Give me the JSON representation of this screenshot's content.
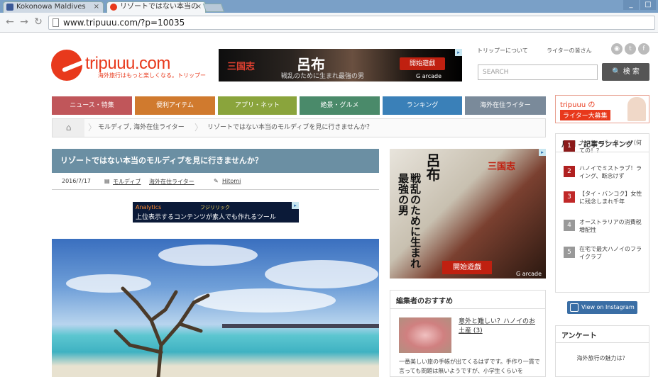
{
  "browser": {
    "tabs": [
      {
        "title": "Kokonowa Maldives",
        "active": false
      },
      {
        "title": "リゾートではない本当の",
        "active": true
      }
    ],
    "url": "www.tripuuu.com/?p=10035",
    "win_buttons": [
      "_",
      "□"
    ]
  },
  "site": {
    "logo": "tripuuu.com",
    "tagline": "海外旅行はもっと楽しくなる。トリップー",
    "header_links": [
      "トリップーについて",
      "ライターの皆さん"
    ],
    "social_icons": [
      "rss-icon",
      "twitter-icon",
      "facebook-icon"
    ],
    "search_placeholder": "SEARCH",
    "search_button": "検 索"
  },
  "nav": [
    {
      "label": "ニュース・特集",
      "color": "#c0565a"
    },
    {
      "label": "便利アイテム",
      "color": "#d07a2e"
    },
    {
      "label": "アプリ・ネット",
      "color": "#8aa43c"
    },
    {
      "label": "絶景・グルメ",
      "color": "#4a8a6a"
    },
    {
      "label": "ランキング",
      "color": "#3a80b8"
    },
    {
      "label": "海外在住ライター",
      "color": "#7a8a9a"
    }
  ],
  "recruit": {
    "line1": "tripuuu の",
    "line2": "ライター大募集"
  },
  "breadcrumb": [
    "モルディブ, 海外在住ライター",
    "リゾートではない本当のモルディブを見に行きませんか？"
  ],
  "article": {
    "title": "リゾートではない本当のモルディブを見に行きませんか？",
    "date": "2016/7/17",
    "categories": [
      "モルディブ",
      "海外在住ライター"
    ],
    "author": "Hitomi"
  },
  "ads": {
    "top": {
      "brand": "三国志",
      "name": "呂布",
      "tagline": "戦乱のために生まれ最強の男",
      "button": "開始遊戯",
      "arcade": "G arcade"
    },
    "mid": {
      "line1": "Analytics",
      "line2": "上位表示するコンテンツが素人でも作れるツール",
      "promo": "フジリリック"
    },
    "side": {
      "name": "呂布",
      "tagline": "戦乱のために生まれ最強の男",
      "logo": "三国志",
      "button": "開始遊戯",
      "arcade": "G arcade"
    }
  },
  "ranking": {
    "title": "月間 - 記事ランキング",
    "items": [
      {
        "num": "1",
        "text": "ナーヒーパーターっ（何ての！？",
        "color": "#8b1a1a"
      },
      {
        "num": "2",
        "text": "ハノイでミストラブ！ライング、断念けず",
        "color": "#b02020"
      },
      {
        "num": "3",
        "text": "【タイ・バンコク】女性に残念しまれ千年",
        "color": "#c02828"
      },
      {
        "num": "4",
        "text": "オーストラリアの消費税増配性",
        "color": "#999999"
      },
      {
        "num": "5",
        "text": "在宅で最大ハノイのフライクラブ",
        "color": "#999999"
      }
    ]
  },
  "recommend": {
    "title": "編集者のおすすめ",
    "item_title": "意外と難しい？ハノイのお土産 (3)",
    "excerpt": "一番美しい旅の手帳が出てくるはずです。手作り一貫で言っても問題は無いようですが、小学生くらいを"
  },
  "instagram": {
    "label": "View on Instagram"
  },
  "survey": {
    "title": "アンケート",
    "question": "海外旅行の魅力は？"
  }
}
